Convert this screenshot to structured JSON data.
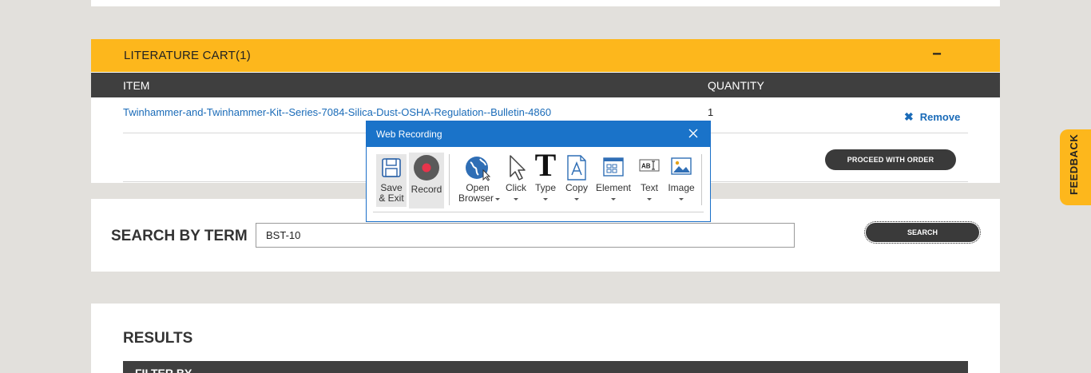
{
  "cart": {
    "title": "LITERATURE CART(1)",
    "collapse": "−",
    "col_item": "ITEM",
    "col_quantity": "QUANTITY",
    "rows": [
      {
        "item": "Twinhammer-and-Twinhammer-Kit--Series-7084-Silica-Dust-OSHA-Regulation--Bulletin-4860",
        "quantity": "1",
        "remove": "Remove"
      }
    ],
    "proceed_label": "PROCEED WITH ORDER"
  },
  "search": {
    "label": "SEARCH BY TERM",
    "value": "BST-10",
    "button": "SEARCH"
  },
  "results": {
    "title": "RESULTS",
    "filter_label": "FILTER BY"
  },
  "feedback": "FEEDBACK",
  "dialog": {
    "title": "Web Recording",
    "tools": {
      "save_line1": "Save",
      "save_line2": "& Exit",
      "record": "Record",
      "open_line1": "Open",
      "open_line2": "Browser",
      "click": "Click",
      "type": "Type",
      "copy": "Copy",
      "element": "Element",
      "text": "Text",
      "image": "Image"
    }
  },
  "colors": {
    "accent_yellow": "#fdb71c",
    "header_dark": "#3f3f3f",
    "link_blue": "#1a6bb8",
    "dialog_blue": "#1a73c9",
    "record_red": "#e8344b"
  }
}
